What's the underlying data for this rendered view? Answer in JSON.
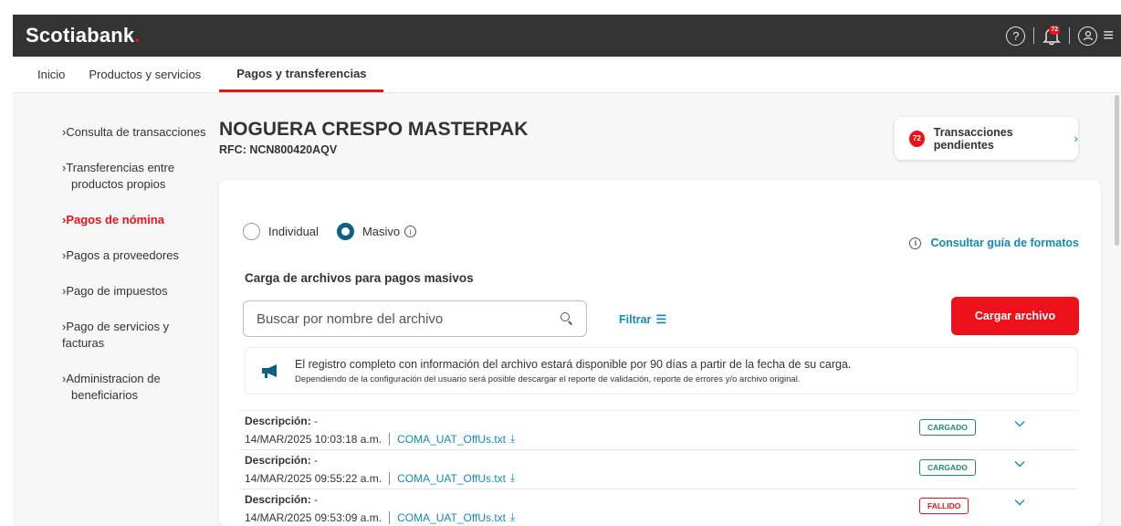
{
  "brand": {
    "logo": "Scotiabank",
    "logo_dot": ".",
    "accent": "#ec111a",
    "link": "#138bb5",
    "dark": "#333333"
  },
  "topbar": {
    "notifications_count": "72",
    "help_icon": "help-circle-icon",
    "bell_icon": "bell-icon",
    "user_icon": "user-circle-icon",
    "menu_icon": "hamburger-icon"
  },
  "nav": {
    "items": [
      "Inicio",
      "Productos y servicios",
      "Pagos y transferencias"
    ]
  },
  "sidebar": {
    "items": [
      {
        "label": "Consulta de transacciones"
      },
      {
        "label": "Transferencias entre",
        "label2": "productos propios"
      },
      {
        "label": "Pagos de nómina"
      },
      {
        "label": "Pagos a proveedores"
      },
      {
        "label": "Pago de impuestos"
      },
      {
        "label": "Pago de servicios y facturas"
      },
      {
        "label": "Administracion de",
        "label2": "beneficiarios"
      }
    ]
  },
  "company": {
    "name": "NOGUERA CRESPO MASTERPAK",
    "rfc": "RFC: NCN800420AQV"
  },
  "pending": {
    "count": "72",
    "label": "Transacciones pendientes"
  },
  "mode": {
    "individual": "Individual",
    "masivo": "Masivo",
    "selected": "Masivo"
  },
  "guide_link": "Consultar guía de formatos",
  "section_title": "Carga de archivos para pagos masivos",
  "search": {
    "placeholder": "Buscar por nombre del archivo",
    "value": ""
  },
  "filter_label": "Filtrar",
  "upload_button": "Cargar archivo",
  "notice": {
    "main": "El registro completo con información del archivo estará disponible por 90 días a partir de la fecha de su carga.",
    "sub": "Dependiendo de la configuración del usuario será posible descargar el reporte de validación, reporte de errores y/o archivo original."
  },
  "files": [
    {
      "desc_label": "Descripción:",
      "desc_value": " -",
      "datetime": "14/MAR/2025 10:03:18 a.m.",
      "file": "COMA_UAT_OffUs.txt",
      "status": "CARGADO"
    },
    {
      "desc_label": "Descripción:",
      "desc_value": " -",
      "datetime": "14/MAR/2025 09:55:22 a.m.",
      "file": "COMA_UAT_OffUs.txt",
      "status": "CARGADO"
    },
    {
      "desc_label": "Descripción:",
      "desc_value": " -",
      "datetime": "14/MAR/2025 09:53:09 a.m.",
      "file": "COMA_UAT_OffUs.txt",
      "status": "FALLIDO"
    }
  ]
}
